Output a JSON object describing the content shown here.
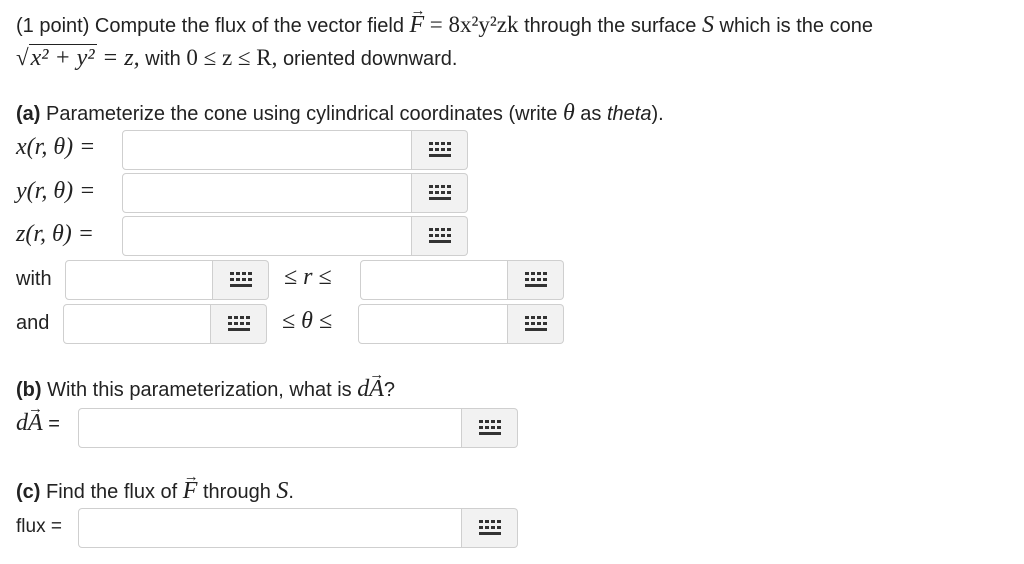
{
  "problem": {
    "intro": "(1 point) Compute the flux of the vector field",
    "field_lhs": "F",
    "field_eq": "= 8x²y²zk",
    "surface_text": "through the surface",
    "surface_var": "S",
    "which_text": "which is the cone",
    "cone_radicand": "x² + y²",
    "cone_rhs": "= z,",
    "with_text": "with",
    "range": "0 ≤ z ≤ R,",
    "oriented": "oriented downward."
  },
  "part_a": {
    "tag": "(a)",
    "text": "Parameterize the cone using cylindrical coordinates (write",
    "theta": "θ",
    "as_text": "as",
    "theta_word": "theta",
    "end": ").",
    "x_label": "x(r, θ) =",
    "y_label": "y(r, θ) =",
    "z_label": "z(r, θ) =",
    "with_label": "with",
    "r_ineq": "≤ r ≤",
    "and_label": "and",
    "theta_ineq": "≤ θ ≤"
  },
  "part_b": {
    "tag": "(b)",
    "text": "With this parameterization, what is",
    "dA": "dA",
    "q": "?",
    "dA_label": "dA",
    "eq": "="
  },
  "part_c": {
    "tag": "(c)",
    "text": "Find the flux of",
    "F": "F",
    "through": "through",
    "S": "S",
    "dot": ".",
    "flux_label": "flux ="
  },
  "inputs": {
    "x": "",
    "y": "",
    "z": "",
    "r_min": "",
    "r_max": "",
    "theta_min": "",
    "theta_max": "",
    "dA": "",
    "flux": ""
  },
  "icons": {
    "keyboard": "keypad-icon"
  }
}
